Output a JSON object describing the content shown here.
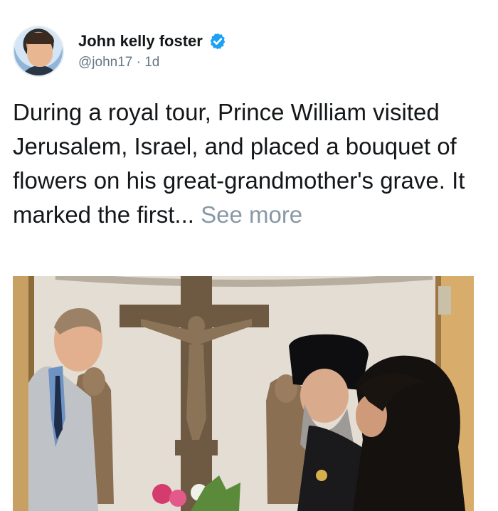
{
  "author": {
    "name": "John kelly foster",
    "handle": "@john17",
    "separator": " · ",
    "time": "1d",
    "verified": true,
    "verified_color": "#1da1f2"
  },
  "tweet": {
    "text": "During a royal tour, Prince William visited Jerusalem, Israel, and placed a bouquet of flowers on his great-grandmother's grave. It marked the first...",
    "see_more": "See more"
  },
  "media": {
    "type": "photo",
    "subject": "chapel-with-crucifix"
  },
  "colors": {
    "text": "#14171a",
    "secondary": "#657786",
    "link_muted": "#8899a6"
  }
}
